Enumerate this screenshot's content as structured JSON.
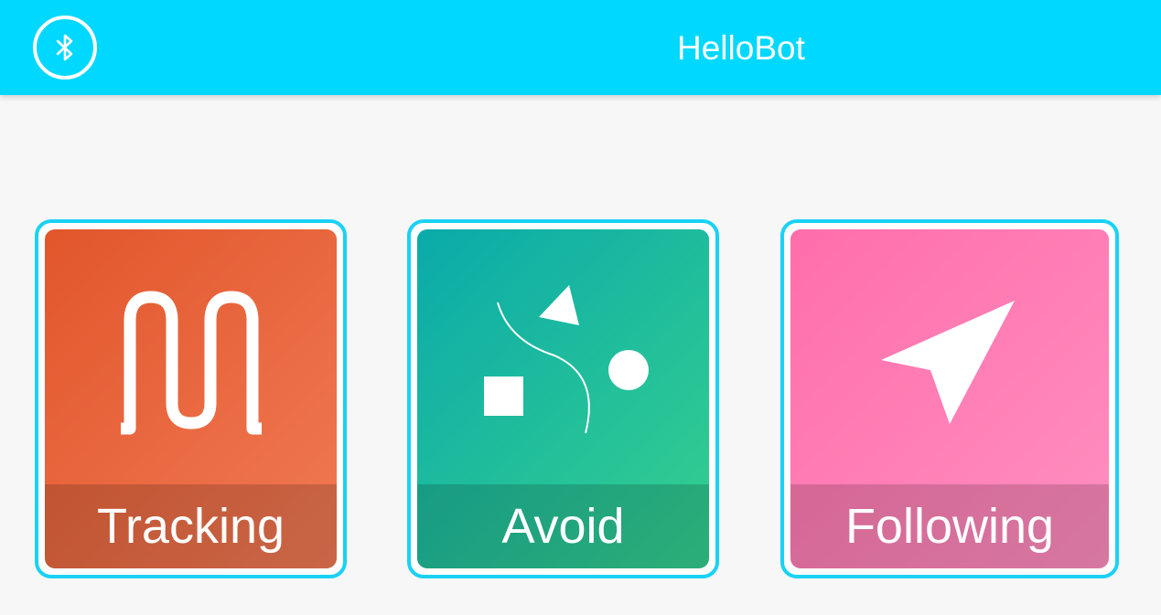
{
  "app_bar": {
    "title": "HelloBot",
    "background_color": "#00d8ff",
    "bluetooth_icon": "bluetooth-icon"
  },
  "modes": [
    {
      "label": "Tracking",
      "icon": "track-line-icon",
      "color": "#e2562b"
    },
    {
      "label": "Avoid",
      "icon": "obstacle-avoid-icon",
      "color": "#0aaaaa"
    },
    {
      "label": "Following",
      "icon": "navigation-arrow-icon",
      "color": "#ff6eaa"
    }
  ],
  "card_border_color": "#19d2f5"
}
